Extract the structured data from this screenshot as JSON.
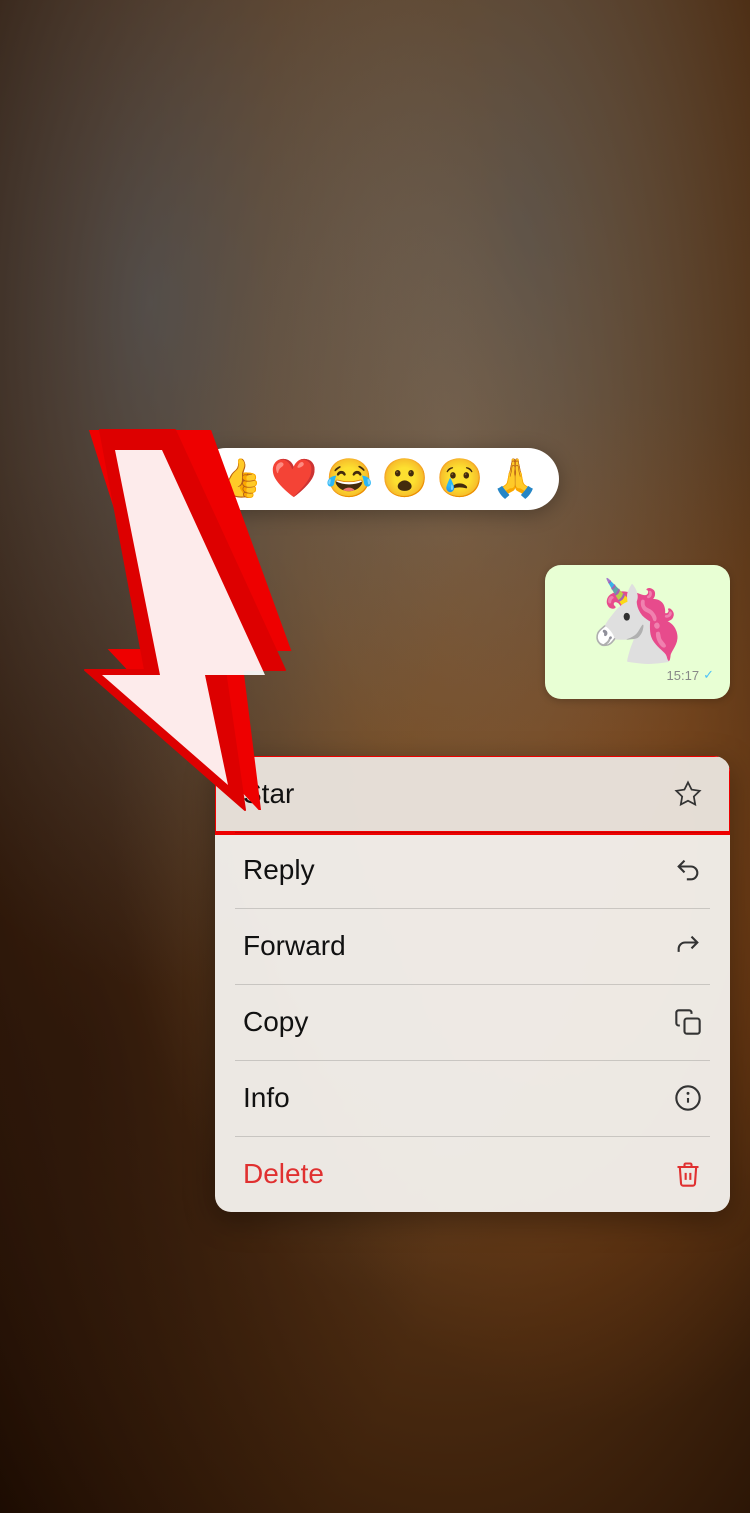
{
  "background": {
    "description": "Blurred warm brown background"
  },
  "emoji_bar": {
    "emojis": [
      "👍",
      "❤️",
      "😂",
      "😮",
      "😢",
      "🙏"
    ]
  },
  "message_bubble": {
    "content": "🦄",
    "time": "15:17",
    "check": "✓"
  },
  "context_menu": {
    "items": [
      {
        "id": "star",
        "label": "Star",
        "icon": "star",
        "highlighted": true,
        "color": "normal"
      },
      {
        "id": "reply",
        "label": "Reply",
        "icon": "reply",
        "highlighted": false,
        "color": "normal"
      },
      {
        "id": "forward",
        "label": "Forward",
        "icon": "forward",
        "highlighted": false,
        "color": "normal"
      },
      {
        "id": "copy",
        "label": "Copy",
        "icon": "copy",
        "highlighted": false,
        "color": "normal"
      },
      {
        "id": "info",
        "label": "Info",
        "icon": "info",
        "highlighted": false,
        "color": "normal"
      },
      {
        "id": "delete",
        "label": "Delete",
        "icon": "trash",
        "highlighted": false,
        "color": "red"
      }
    ]
  }
}
